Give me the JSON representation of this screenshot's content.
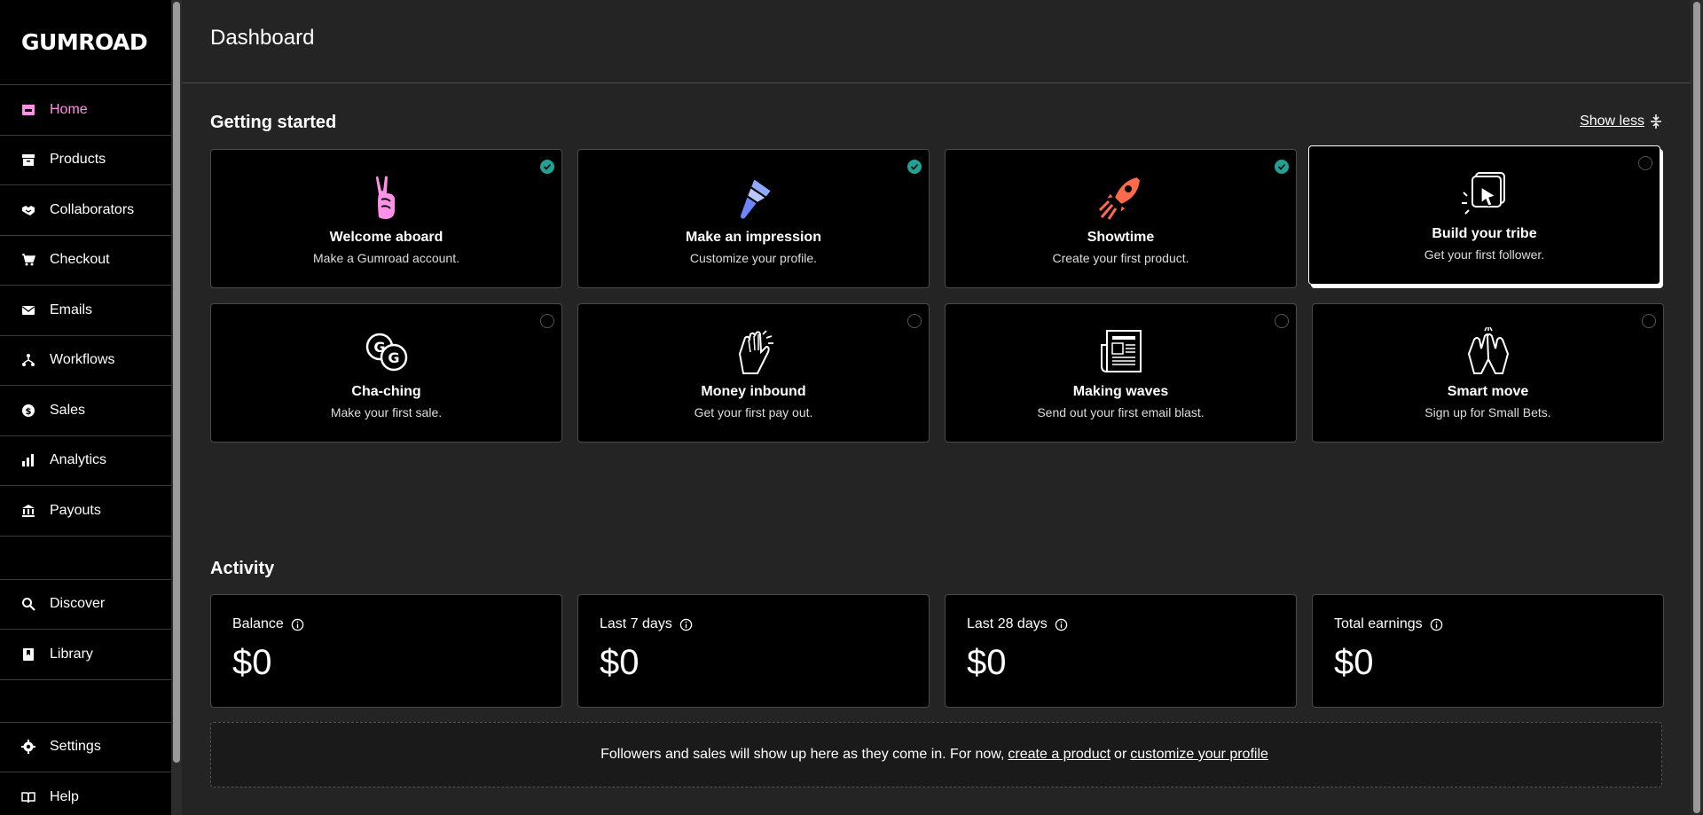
{
  "brand": {
    "logo_text": "GUMROAD"
  },
  "sidebar": {
    "items": [
      {
        "label": "Home",
        "icon": "home-icon"
      },
      {
        "label": "Products",
        "icon": "archive-icon"
      },
      {
        "label": "Collaborators",
        "icon": "handshake-icon"
      },
      {
        "label": "Checkout",
        "icon": "cart-icon"
      },
      {
        "label": "Emails",
        "icon": "envelope-icon"
      },
      {
        "label": "Workflows",
        "icon": "workflow-icon"
      },
      {
        "label": "Sales",
        "icon": "dollar-circle-icon"
      },
      {
        "label": "Analytics",
        "icon": "bar-chart-icon"
      },
      {
        "label": "Payouts",
        "icon": "bank-icon"
      }
    ],
    "secondary": [
      {
        "label": "Discover",
        "icon": "search-icon"
      },
      {
        "label": "Library",
        "icon": "bookmark-icon"
      }
    ],
    "bottom": [
      {
        "label": "Settings",
        "icon": "gear-icon"
      },
      {
        "label": "Help",
        "icon": "book-icon"
      }
    ],
    "active_color": "#ff90e8"
  },
  "header": {
    "title": "Dashboard"
  },
  "getting_started": {
    "title": "Getting started",
    "toggle_label": "Show less",
    "cards": [
      {
        "title": "Welcome aboard",
        "subtitle": "Make a Gumroad account.",
        "completed": true,
        "icon": "peace-hand-icon"
      },
      {
        "title": "Make an impression",
        "subtitle": "Customize your profile.",
        "completed": true,
        "icon": "paintbrush-icon"
      },
      {
        "title": "Showtime",
        "subtitle": "Create your first product.",
        "completed": true,
        "icon": "rocket-icon"
      },
      {
        "title": "Build your tribe",
        "subtitle": "Get your first follower.",
        "completed": false,
        "icon": "cursor-sparkle-icon"
      },
      {
        "title": "Cha-ching",
        "subtitle": "Make your first sale.",
        "completed": false,
        "icon": "coins-icon"
      },
      {
        "title": "Money inbound",
        "subtitle": "Get your first pay out.",
        "completed": false,
        "icon": "clapping-hands-icon"
      },
      {
        "title": "Making waves",
        "subtitle": "Send out your first email blast.",
        "completed": false,
        "icon": "newspaper-icon"
      },
      {
        "title": "Smart move",
        "subtitle": "Sign up for Small Bets.",
        "completed": false,
        "icon": "raised-hands-icon"
      }
    ]
  },
  "activity": {
    "title": "Activity",
    "stats": [
      {
        "label": "Balance",
        "value": "$0"
      },
      {
        "label": "Last 7 days",
        "value": "$0"
      },
      {
        "label": "Last 28 days",
        "value": "$0"
      },
      {
        "label": "Total earnings",
        "value": "$0"
      }
    ],
    "notice": {
      "prefix": "Followers and sales will show up here as they come in. For now,",
      "link1": "create a product",
      "middle": "or",
      "link2": "customize your profile"
    }
  },
  "colors": {
    "accent": "#ff90e8",
    "check": "#23a094",
    "rocket": "#ff6a4a",
    "brush": "#90a8ff"
  }
}
